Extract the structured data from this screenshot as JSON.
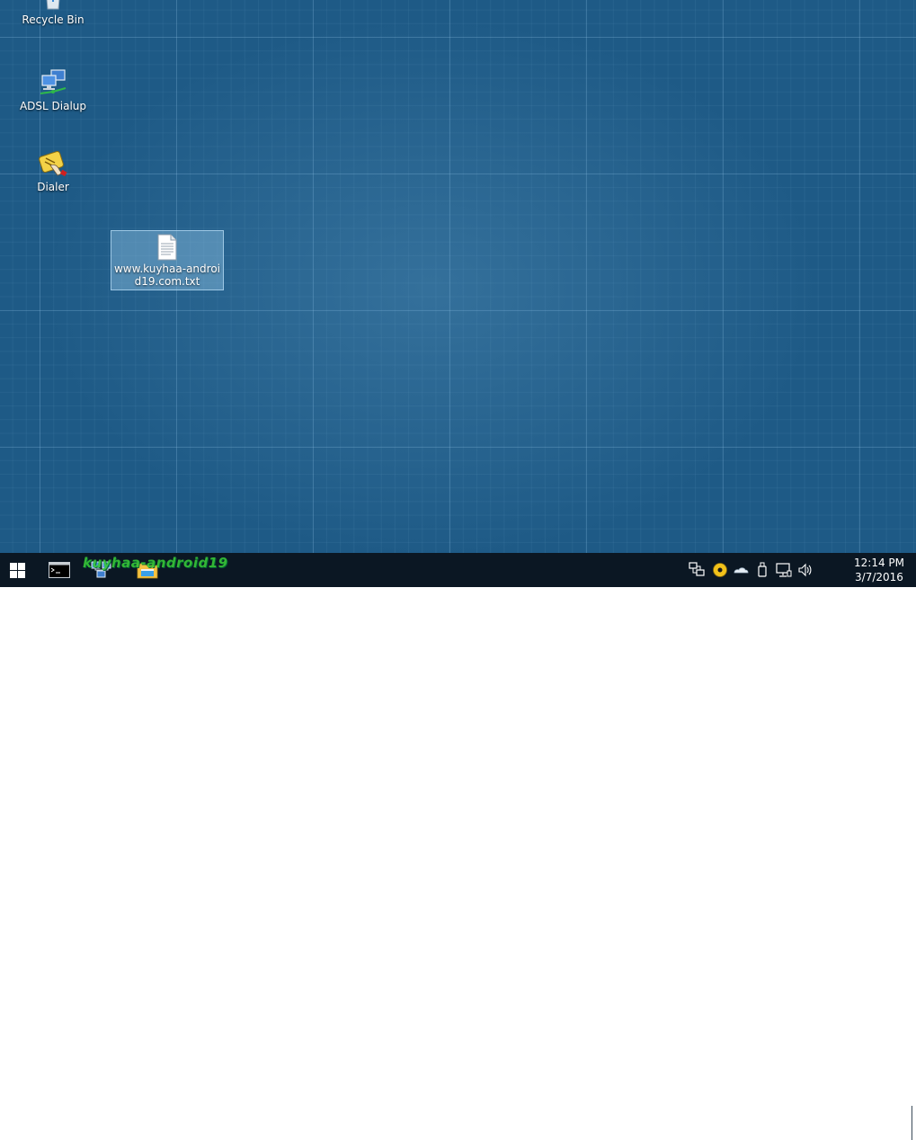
{
  "desktop": {
    "icons": [
      {
        "label": "Recycle Bin",
        "icon": "recycle-bin-icon"
      },
      {
        "label": "ADSL Dialup",
        "icon": "network-computers-icon"
      },
      {
        "label": "Dialer",
        "icon": "dialer-icon"
      },
      {
        "label": "www.kuyhaa-android19.com.txt",
        "icon": "text-file-icon",
        "selected": true
      }
    ]
  },
  "taskbar": {
    "start_icon": "windows-logo-icon",
    "apps": [
      {
        "icon": "command-prompt-icon"
      },
      {
        "icon": "network-app-icon"
      },
      {
        "icon": "file-explorer-icon"
      }
    ],
    "watermark": "kuyhaa-android19",
    "tray_icons": [
      "network-manager-icon",
      "media-disc-icon",
      "cloud-icon",
      "usb-device-icon",
      "network-icon",
      "volume-icon"
    ],
    "clock": {
      "time": "12:14 PM",
      "date": "3/7/2016"
    }
  },
  "colors": {
    "desktop_bg": "#1e5a86",
    "taskbar_bg": "#0b1723",
    "selection_bg": "#8cbee1",
    "watermark_green": "#38c838"
  }
}
